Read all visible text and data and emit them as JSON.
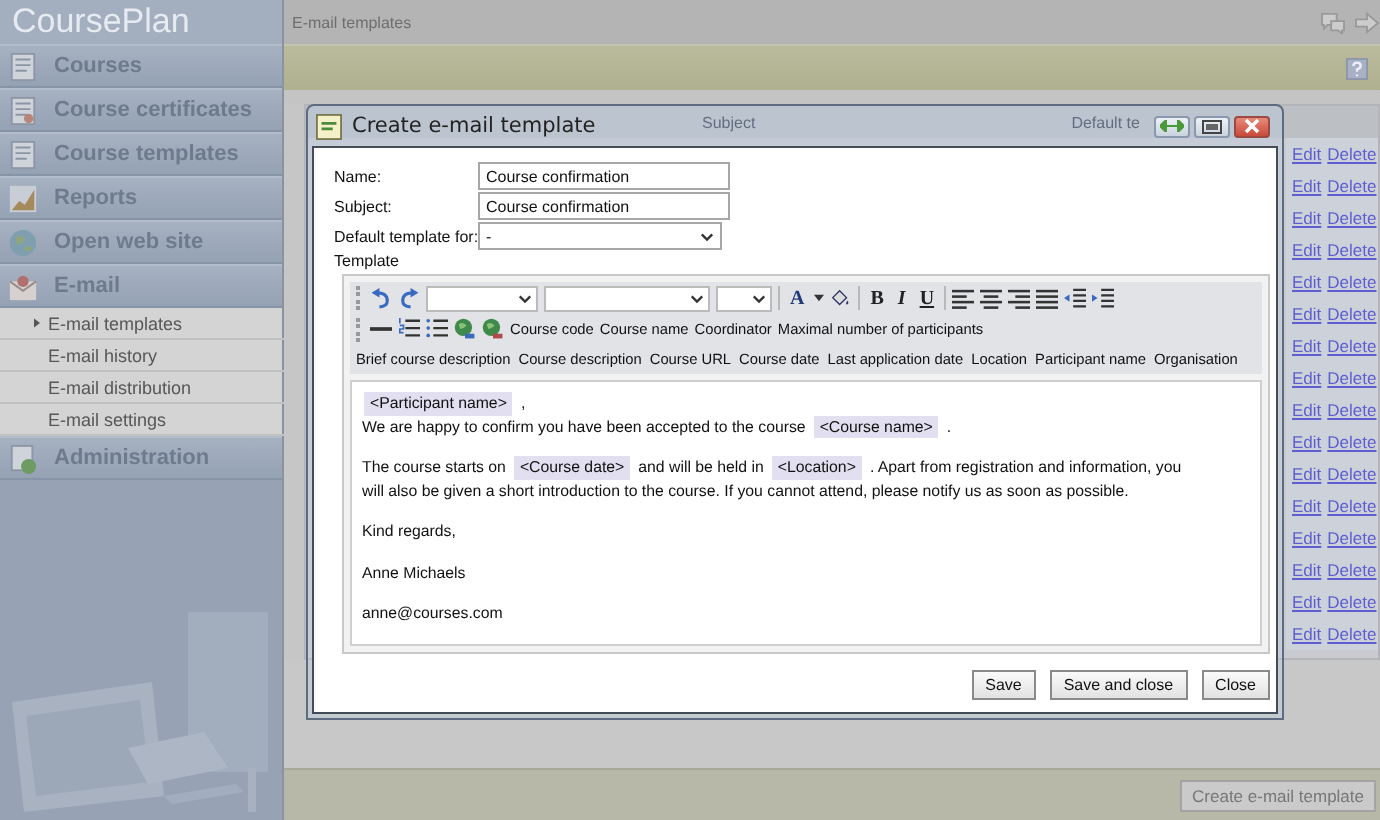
{
  "app": {
    "title": "CoursePlan"
  },
  "sidebar": {
    "items": [
      {
        "label": "Courses"
      },
      {
        "label": "Course certificates"
      },
      {
        "label": "Course templates"
      },
      {
        "label": "Reports"
      },
      {
        "label": "Open web site"
      },
      {
        "label": "E-mail",
        "expanded": true,
        "children": [
          {
            "label": "E-mail templates",
            "selected": true
          },
          {
            "label": "E-mail history",
            "selected": false
          },
          {
            "label": "E-mail distribution",
            "selected": false
          },
          {
            "label": "E-mail settings",
            "selected": false
          }
        ]
      },
      {
        "label": "Administration"
      }
    ]
  },
  "breadcrumb": "E-mail templates",
  "table": {
    "columns": [
      "Subject",
      "Default te"
    ],
    "rows": [
      {
        "edit": "Edit",
        "delete": "Delete"
      },
      {
        "edit": "Edit",
        "delete": "Delete"
      },
      {
        "edit": "Edit",
        "delete": "Delete"
      },
      {
        "edit": "Edit",
        "delete": "Delete"
      },
      {
        "edit": "Edit",
        "delete": "Delete"
      },
      {
        "edit": "Edit",
        "delete": "Delete"
      },
      {
        "edit": "Edit",
        "delete": "Delete"
      },
      {
        "edit": "Edit",
        "delete": "Delete"
      },
      {
        "edit": "Edit",
        "delete": "Delete"
      },
      {
        "edit": "Edit",
        "delete": "Delete"
      },
      {
        "edit": "Edit",
        "delete": "Delete"
      },
      {
        "edit": "Edit",
        "delete": "Delete"
      },
      {
        "edit": "Edit",
        "delete": "Delete"
      },
      {
        "edit": "Edit",
        "delete": "Delete"
      },
      {
        "edit": "Edit",
        "delete": "Delete"
      },
      {
        "edit": "Edit",
        "delete": "Delete"
      }
    ]
  },
  "create_button": "Create e-mail template",
  "dialog": {
    "title": "Create e-mail template",
    "fields": [
      {
        "kind": "text",
        "label": "Name:",
        "value": "Course confirmation"
      },
      {
        "kind": "text",
        "label": "Subject:",
        "value": "Course confirmation"
      },
      {
        "kind": "select",
        "label": "Default template for:",
        "value": "-"
      }
    ],
    "template_label": "Template",
    "toolbar": {
      "font_color": "A",
      "format": [
        "B",
        "I",
        "U"
      ],
      "field_rows": [
        [
          "Course code",
          "Course name",
          "Coordinator",
          "Maximal number of participants"
        ],
        [
          "Brief course description",
          "Course description",
          "Course URL",
          "Course date",
          "Last application date",
          "Location",
          "Participant name",
          "Organisation"
        ]
      ]
    },
    "body": [
      {
        "lines": [
          [
            {
              "kind": "tag",
              "text": "<Participant name>"
            },
            {
              "kind": "text",
              "text": ","
            }
          ],
          [
            {
              "kind": "text",
              "text": "We are happy to confirm you have been accepted to the course"
            },
            {
              "kind": "tag",
              "text": "<Course name>"
            },
            {
              "kind": "text",
              "text": "."
            }
          ]
        ]
      },
      {
        "lines": [
          [
            {
              "kind": "text",
              "text": "The course starts on"
            },
            {
              "kind": "tag",
              "text": "<Course date>"
            },
            {
              "kind": "text",
              "text": "and will be held in"
            },
            {
              "kind": "tag",
              "text": "<Location>"
            },
            {
              "kind": "text",
              "text": ". Apart from registration and information, you"
            }
          ],
          [
            {
              "kind": "text",
              "text": "will also be given a short introduction to the course. If you cannot attend, please notify us as soon as possible."
            }
          ]
        ]
      },
      {
        "lines": [
          [
            {
              "kind": "text",
              "text": "Kind regards,"
            }
          ]
        ]
      },
      {
        "lines": [
          [
            {
              "kind": "text",
              "text": "Anne Michaels"
            }
          ]
        ]
      },
      {
        "lines": [
          [
            {
              "kind": "text",
              "text": "anne@courses.com"
            }
          ]
        ]
      }
    ],
    "buttons": [
      "Save",
      "Save and close",
      "Close"
    ]
  }
}
